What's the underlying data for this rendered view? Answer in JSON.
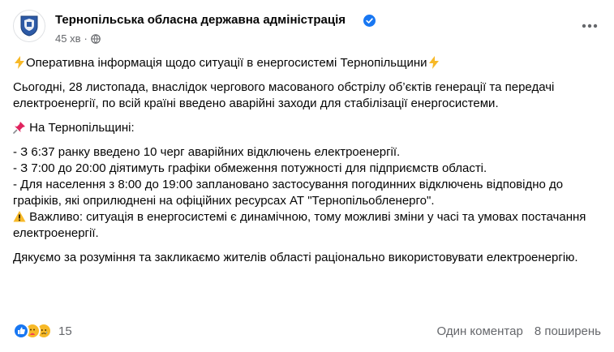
{
  "post": {
    "page_name": "Тернопільська обласна державна адміністрація",
    "time": "45 хв",
    "separator": "·",
    "title": "Оперативна інформація щодо ситуації в енергосистемі Тернопільщини",
    "intro": "Сьогодні, 28 листопада, внаслідок чергового масованого обстрілу об’єктів генерації та передачі електроенергії, по всій країні введено аварійні заходи для стабілізації енергосистеми.",
    "region_heading": "На Тернопільщині:",
    "items": [
      "- З 6:37 ранку введено 10 черг аварійних відключень електроенергії.",
      "- З 7:00 до 20:00 діятимуть графіки обмеження потужності для підприємств області.",
      "- Для населення з 8:00 до 19:00 заплановано застосування погодинних відключень відповідно до графіків, які оприлюднені на офіційних ресурсах АТ \"Тернопільобленерго\"."
    ],
    "warning": "Важливо: ситуація в енергосистемі є динамічною, тому можливі зміни у часі та умовах постачання електроенергії.",
    "closing": "Дякуємо за розуміння та закликаємо жителів області раціонально використовувати електроенергію."
  },
  "footer": {
    "reactions_count": "15",
    "comments": "Один коментар",
    "shares": "8 поширень"
  },
  "icons": {
    "avatar": "coat-of-arms-icon",
    "verified": "verified-badge-icon",
    "audience": "globe-icon",
    "more": "more-options-icon",
    "lightning": "lightning-icon",
    "pin": "pushpin-icon",
    "warning": "warning-icon",
    "reactions": [
      "like-icon",
      "care-icon",
      "sad-icon"
    ]
  },
  "colors": {
    "accent": "#1877f2",
    "secondary_text": "#65676b",
    "lightning": "#f7b928"
  }
}
